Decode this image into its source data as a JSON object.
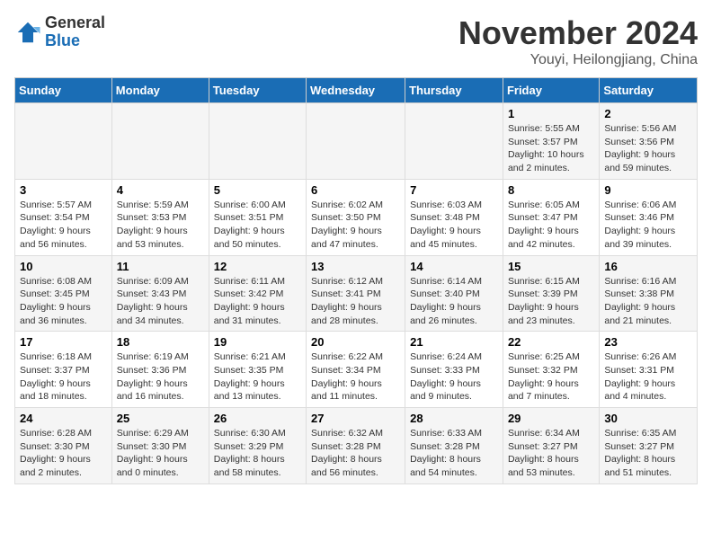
{
  "logo": {
    "general": "General",
    "blue": "Blue"
  },
  "title": {
    "month_year": "November 2024",
    "location": "Youyi, Heilongjiang, China"
  },
  "headers": [
    "Sunday",
    "Monday",
    "Tuesday",
    "Wednesday",
    "Thursday",
    "Friday",
    "Saturday"
  ],
  "weeks": [
    [
      {
        "day": "",
        "info": ""
      },
      {
        "day": "",
        "info": ""
      },
      {
        "day": "",
        "info": ""
      },
      {
        "day": "",
        "info": ""
      },
      {
        "day": "",
        "info": ""
      },
      {
        "day": "1",
        "info": "Sunrise: 5:55 AM\nSunset: 3:57 PM\nDaylight: 10 hours and 2 minutes."
      },
      {
        "day": "2",
        "info": "Sunrise: 5:56 AM\nSunset: 3:56 PM\nDaylight: 9 hours and 59 minutes."
      }
    ],
    [
      {
        "day": "3",
        "info": "Sunrise: 5:57 AM\nSunset: 3:54 PM\nDaylight: 9 hours and 56 minutes."
      },
      {
        "day": "4",
        "info": "Sunrise: 5:59 AM\nSunset: 3:53 PM\nDaylight: 9 hours and 53 minutes."
      },
      {
        "day": "5",
        "info": "Sunrise: 6:00 AM\nSunset: 3:51 PM\nDaylight: 9 hours and 50 minutes."
      },
      {
        "day": "6",
        "info": "Sunrise: 6:02 AM\nSunset: 3:50 PM\nDaylight: 9 hours and 47 minutes."
      },
      {
        "day": "7",
        "info": "Sunrise: 6:03 AM\nSunset: 3:48 PM\nDaylight: 9 hours and 45 minutes."
      },
      {
        "day": "8",
        "info": "Sunrise: 6:05 AM\nSunset: 3:47 PM\nDaylight: 9 hours and 42 minutes."
      },
      {
        "day": "9",
        "info": "Sunrise: 6:06 AM\nSunset: 3:46 PM\nDaylight: 9 hours and 39 minutes."
      }
    ],
    [
      {
        "day": "10",
        "info": "Sunrise: 6:08 AM\nSunset: 3:45 PM\nDaylight: 9 hours and 36 minutes."
      },
      {
        "day": "11",
        "info": "Sunrise: 6:09 AM\nSunset: 3:43 PM\nDaylight: 9 hours and 34 minutes."
      },
      {
        "day": "12",
        "info": "Sunrise: 6:11 AM\nSunset: 3:42 PM\nDaylight: 9 hours and 31 minutes."
      },
      {
        "day": "13",
        "info": "Sunrise: 6:12 AM\nSunset: 3:41 PM\nDaylight: 9 hours and 28 minutes."
      },
      {
        "day": "14",
        "info": "Sunrise: 6:14 AM\nSunset: 3:40 PM\nDaylight: 9 hours and 26 minutes."
      },
      {
        "day": "15",
        "info": "Sunrise: 6:15 AM\nSunset: 3:39 PM\nDaylight: 9 hours and 23 minutes."
      },
      {
        "day": "16",
        "info": "Sunrise: 6:16 AM\nSunset: 3:38 PM\nDaylight: 9 hours and 21 minutes."
      }
    ],
    [
      {
        "day": "17",
        "info": "Sunrise: 6:18 AM\nSunset: 3:37 PM\nDaylight: 9 hours and 18 minutes."
      },
      {
        "day": "18",
        "info": "Sunrise: 6:19 AM\nSunset: 3:36 PM\nDaylight: 9 hours and 16 minutes."
      },
      {
        "day": "19",
        "info": "Sunrise: 6:21 AM\nSunset: 3:35 PM\nDaylight: 9 hours and 13 minutes."
      },
      {
        "day": "20",
        "info": "Sunrise: 6:22 AM\nSunset: 3:34 PM\nDaylight: 9 hours and 11 minutes."
      },
      {
        "day": "21",
        "info": "Sunrise: 6:24 AM\nSunset: 3:33 PM\nDaylight: 9 hours and 9 minutes."
      },
      {
        "day": "22",
        "info": "Sunrise: 6:25 AM\nSunset: 3:32 PM\nDaylight: 9 hours and 7 minutes."
      },
      {
        "day": "23",
        "info": "Sunrise: 6:26 AM\nSunset: 3:31 PM\nDaylight: 9 hours and 4 minutes."
      }
    ],
    [
      {
        "day": "24",
        "info": "Sunrise: 6:28 AM\nSunset: 3:30 PM\nDaylight: 9 hours and 2 minutes."
      },
      {
        "day": "25",
        "info": "Sunrise: 6:29 AM\nSunset: 3:30 PM\nDaylight: 9 hours and 0 minutes."
      },
      {
        "day": "26",
        "info": "Sunrise: 6:30 AM\nSunset: 3:29 PM\nDaylight: 8 hours and 58 minutes."
      },
      {
        "day": "27",
        "info": "Sunrise: 6:32 AM\nSunset: 3:28 PM\nDaylight: 8 hours and 56 minutes."
      },
      {
        "day": "28",
        "info": "Sunrise: 6:33 AM\nSunset: 3:28 PM\nDaylight: 8 hours and 54 minutes."
      },
      {
        "day": "29",
        "info": "Sunrise: 6:34 AM\nSunset: 3:27 PM\nDaylight: 8 hours and 53 minutes."
      },
      {
        "day": "30",
        "info": "Sunrise: 6:35 AM\nSunset: 3:27 PM\nDaylight: 8 hours and 51 minutes."
      }
    ]
  ]
}
